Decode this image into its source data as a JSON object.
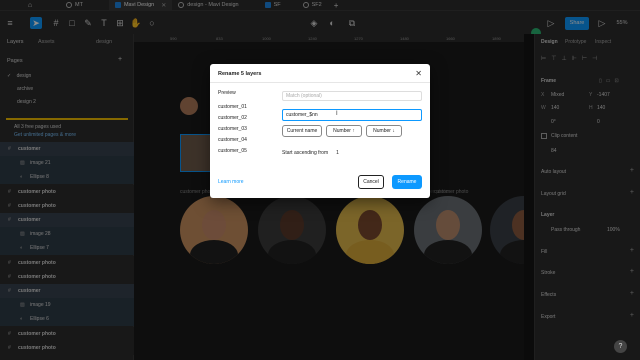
{
  "tabs": [
    {
      "label": "",
      "icon": "home-icon"
    },
    {
      "label": "MT"
    },
    {
      "label": "Mavi Design",
      "active": true
    },
    {
      "label": "design - Mavi Design"
    },
    {
      "label": "SF"
    },
    {
      "label": "SF2"
    }
  ],
  "toolbar": {
    "share_label": "Share",
    "zoom": "55%"
  },
  "left_panel": {
    "tab_layers": "Layers",
    "tab_assets": "Assets",
    "file_label": "design",
    "pages_title": "Pages",
    "pages": [
      "design",
      "archive",
      "design 2"
    ],
    "plan_line1": "All 3 free pages used",
    "plan_line2": "Get unlimited pages & more",
    "layers": [
      {
        "name": "customer",
        "kind": "frame",
        "bold": true
      },
      {
        "name": "image 21",
        "kind": "child"
      },
      {
        "name": "Ellipse 8",
        "kind": "child"
      },
      {
        "name": "customer photo",
        "kind": "frame-dark",
        "bold": true
      },
      {
        "name": "customer photo",
        "kind": "frame-dark",
        "bold": true
      },
      {
        "name": "customer",
        "kind": "frame",
        "bold": true
      },
      {
        "name": "image 28",
        "kind": "child"
      },
      {
        "name": "Ellipse 7",
        "kind": "child"
      },
      {
        "name": "customer photo",
        "kind": "frame-dark",
        "bold": true
      },
      {
        "name": "customer photo",
        "kind": "frame-dark",
        "bold": true
      },
      {
        "name": "customer",
        "kind": "frame",
        "bold": true
      },
      {
        "name": "image 19",
        "kind": "child"
      },
      {
        "name": "Ellipse 6",
        "kind": "child"
      },
      {
        "name": "customer photo",
        "kind": "frame-dark",
        "bold": true
      },
      {
        "name": "customer photo",
        "kind": "frame-dark",
        "bold": true
      }
    ]
  },
  "canvas": {
    "ruler_ticks": [
      "590",
      "833",
      "1000",
      "1240",
      "1270",
      "1480",
      "1660",
      "1890"
    ],
    "photo_labels": [
      "customer photo",
      "customer photo",
      "customer photo",
      "customer photo"
    ]
  },
  "right_panel": {
    "tab_design": "Design",
    "tab_prototype": "Prototype",
    "tab_inspect": "Inspect",
    "frame_label": "Frame",
    "x_value": "Mixed",
    "y_value": "-1407",
    "w_value": "140",
    "h_value": "140",
    "rotation": "0°",
    "radius": "0",
    "clip_label": "Clip content",
    "opacity_label": "84",
    "auto_layout": "Auto layout",
    "layout_grid": "Layout grid",
    "layer_title": "Layer",
    "blend": "Pass through",
    "layer_opacity": "100%",
    "fill": "Fill",
    "stroke": "Stroke",
    "effects": "Effects",
    "export": "Export"
  },
  "dialog": {
    "title": "Rename 5 layers",
    "preview_label": "Preview",
    "preview_names": [
      "customer_01",
      "customer_02",
      "customer_03",
      "customer_04",
      "customer_05"
    ],
    "match_placeholder": "Match (optional)",
    "rename_value": "customer_$nn",
    "btn_current_name": "Current name",
    "btn_number_up": "Number ↑",
    "btn_number_down": "Number ↓",
    "start_label": "Start ascending from",
    "start_value": "1",
    "learn_more": "Learn more",
    "cancel": "Cancel",
    "rename": "Rename"
  },
  "colors": {
    "accent": "#0d99ff",
    "panel": "#2c2c2c",
    "canvas": "#1a1a1a"
  }
}
